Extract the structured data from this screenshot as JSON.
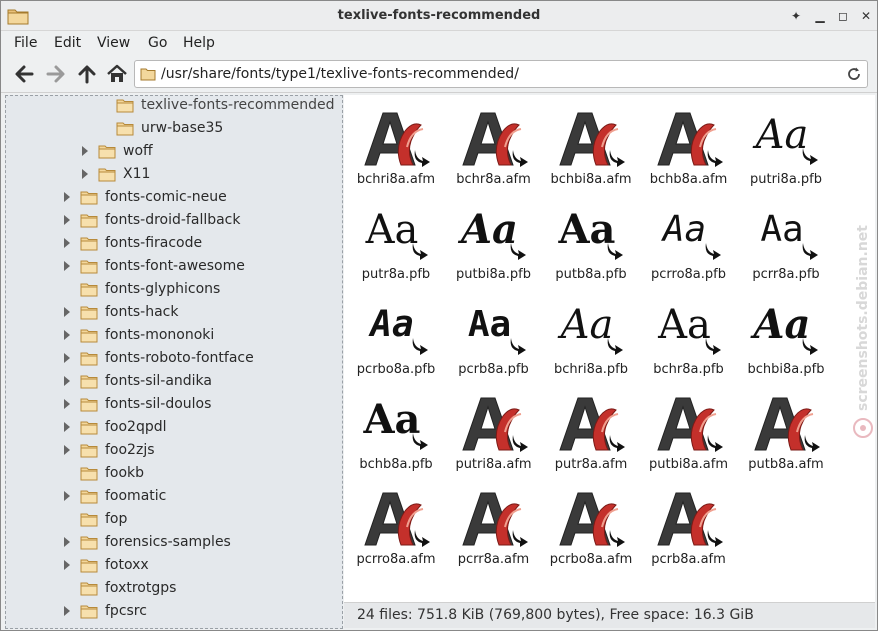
{
  "window": {
    "title": "texlive-fonts-recommended"
  },
  "menu": [
    "File",
    "Edit",
    "View",
    "Go",
    "Help"
  ],
  "address": {
    "path": "/usr/share/fonts/type1/texlive-fonts-recommended/"
  },
  "tree": [
    {
      "label": "texlive-fonts-recommended",
      "expander": false,
      "selected": true
    },
    {
      "label": "urw-base35",
      "expander": false
    },
    {
      "label": "woff",
      "expander": true
    },
    {
      "label": "X11",
      "expander": true
    },
    {
      "label": "fonts-comic-neue",
      "expander": true
    },
    {
      "label": "fonts-droid-fallback",
      "expander": true
    },
    {
      "label": "fonts-firacode",
      "expander": true
    },
    {
      "label": "fonts-font-awesome",
      "expander": true
    },
    {
      "label": "fonts-glyphicons",
      "expander": false
    },
    {
      "label": "fonts-hack",
      "expander": true
    },
    {
      "label": "fonts-mononoki",
      "expander": true
    },
    {
      "label": "fonts-roboto-fontface",
      "expander": true
    },
    {
      "label": "fonts-sil-andika",
      "expander": true
    },
    {
      "label": "fonts-sil-doulos",
      "expander": true
    },
    {
      "label": "foo2qpdl",
      "expander": true
    },
    {
      "label": "foo2zjs",
      "expander": true
    },
    {
      "label": "fookb",
      "expander": false
    },
    {
      "label": "foomatic",
      "expander": true
    },
    {
      "label": "fop",
      "expander": false
    },
    {
      "label": "forensics-samples",
      "expander": true
    },
    {
      "label": "fotoxx",
      "expander": true
    },
    {
      "label": "foxtrotgps",
      "expander": false
    },
    {
      "label": "fpcsrc",
      "expander": true
    }
  ],
  "files": [
    {
      "name": "bchri8a.afm",
      "icon": "afm-font-icon"
    },
    {
      "name": "bchr8a.afm",
      "icon": "afm-font-icon"
    },
    {
      "name": "bchbi8a.afm",
      "icon": "afm-font-icon"
    },
    {
      "name": "bchb8a.afm",
      "icon": "afm-font-icon"
    },
    {
      "name": "putri8a.pfb",
      "icon": "type1-font-icon",
      "preview": "Aa",
      "style": "italic"
    },
    {
      "name": "putr8a.pfb",
      "icon": "type1-font-icon",
      "preview": "Aa",
      "style": "regular"
    },
    {
      "name": "putbi8a.pfb",
      "icon": "type1-font-icon",
      "preview": "Aa",
      "style": "bolditalic"
    },
    {
      "name": "putb8a.pfb",
      "icon": "type1-font-icon",
      "preview": "Aa",
      "style": "bold"
    },
    {
      "name": "pcrro8a.pfb",
      "icon": "type1-font-icon",
      "preview": "Aa",
      "style": "monoitalic"
    },
    {
      "name": "pcrr8a.pfb",
      "icon": "type1-font-icon",
      "preview": "Aa",
      "style": "mono"
    },
    {
      "name": "pcrbo8a.pfb",
      "icon": "type1-font-icon",
      "preview": "Aa",
      "style": "monobolditalic"
    },
    {
      "name": "pcrb8a.pfb",
      "icon": "type1-font-icon",
      "preview": "Aa",
      "style": "monobold"
    },
    {
      "name": "bchri8a.pfb",
      "icon": "type1-font-icon",
      "preview": "Aa",
      "style": "italic"
    },
    {
      "name": "bchr8a.pfb",
      "icon": "type1-font-icon",
      "preview": "Aa",
      "style": "regular"
    },
    {
      "name": "bchbi8a.pfb",
      "icon": "type1-font-icon",
      "preview": "Aa",
      "style": "bolditalic"
    },
    {
      "name": "bchb8a.pfb",
      "icon": "type1-font-icon",
      "preview": "Aa",
      "style": "bold"
    },
    {
      "name": "putri8a.afm",
      "icon": "afm-font-icon"
    },
    {
      "name": "putr8a.afm",
      "icon": "afm-font-icon"
    },
    {
      "name": "putbi8a.afm",
      "icon": "afm-font-icon"
    },
    {
      "name": "putb8a.afm",
      "icon": "afm-font-icon"
    },
    {
      "name": "pcrro8a.afm",
      "icon": "afm-font-icon"
    },
    {
      "name": "pcrr8a.afm",
      "icon": "afm-font-icon"
    },
    {
      "name": "pcrbo8a.afm",
      "icon": "afm-font-icon"
    },
    {
      "name": "pcrb8a.afm",
      "icon": "afm-font-icon"
    }
  ],
  "status": {
    "text": "24 files: 751.8  KiB (769,800 bytes), Free space: 16.3  GiB"
  },
  "watermark": {
    "text": "screenshots.debian.net"
  },
  "colors": {
    "folder": "#e8b85c",
    "afm_red": "#c4302b",
    "afm_gray": "#3a3a3a",
    "sidebar_bg": "#e4e8ec"
  }
}
